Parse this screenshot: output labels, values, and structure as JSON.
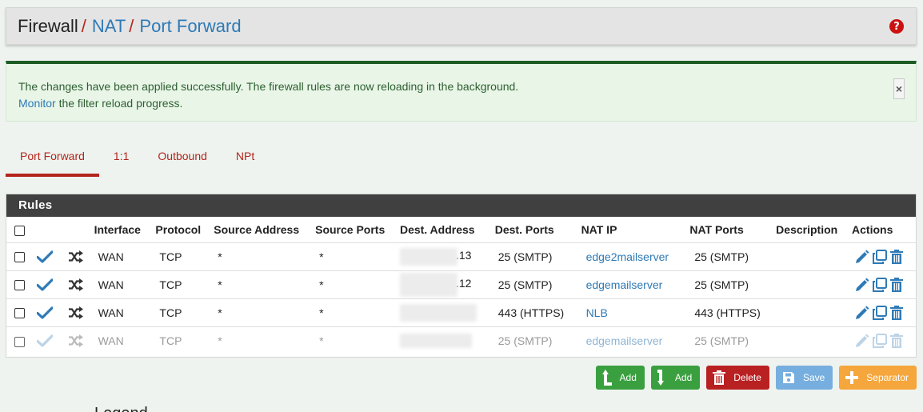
{
  "breadcrumb": {
    "items": [
      "Firewall",
      "NAT",
      "Port Forward"
    ],
    "separator": "/"
  },
  "alert": {
    "line1": "The changes have been applied successfully. The firewall rules are now reloading in the background.",
    "monitor_link": "Monitor",
    "line2_rest": " the filter reload progress.",
    "close_label": "×"
  },
  "help_icon": "?",
  "tabs": [
    {
      "label": "Port Forward",
      "active": true
    },
    {
      "label": "1:1",
      "active": false
    },
    {
      "label": "Outbound",
      "active": false
    },
    {
      "label": "NPt",
      "active": false
    }
  ],
  "panel": {
    "title": "Rules",
    "columns": [
      "Interface",
      "Protocol",
      "Source Address",
      "Source Ports",
      "Dest. Address",
      "Dest. Ports",
      "NAT IP",
      "NAT Ports",
      "Description",
      "Actions"
    ],
    "rows": [
      {
        "enabled": true,
        "interface": "WAN",
        "protocol": "TCP",
        "src_addr": "*",
        "src_ports": "*",
        "dest_suffix": ".13",
        "dest_ports": "25 (SMTP)",
        "nat_ip": "edge2mailserver",
        "nat_ports": "25 (SMTP)",
        "description": ""
      },
      {
        "enabled": true,
        "interface": "WAN",
        "protocol": "TCP",
        "src_addr": "*",
        "src_ports": "*",
        "dest_suffix": ".12",
        "dest_ports": "25 (SMTP)",
        "nat_ip": "edgemailserver",
        "nat_ports": "25 (SMTP)",
        "description": ""
      },
      {
        "enabled": true,
        "interface": "WAN",
        "protocol": "TCP",
        "src_addr": "*",
        "src_ports": "*",
        "dest_suffix": "",
        "dest_ports": "443 (HTTPS)",
        "nat_ip": "NLB",
        "nat_ports": "443 (HTTPS)",
        "description": ""
      },
      {
        "enabled": false,
        "interface": "WAN",
        "protocol": "TCP",
        "src_addr": "*",
        "src_ports": "*",
        "dest_suffix": "",
        "dest_ports": "25 (SMTP)",
        "nat_ip": "edgemailserver",
        "nat_ports": "25 (SMTP)",
        "description": ""
      }
    ]
  },
  "buttons": {
    "add_top": "Add",
    "add_bottom": "Add",
    "delete": "Delete",
    "save": "Save",
    "separator": "Separator"
  },
  "bottom_fragment": "Legend",
  "icons": {
    "enabled": "check-icon",
    "rule_type": "shuffle-icon",
    "edit": "pencil-icon",
    "copy": "copy-icon",
    "delete": "trash-icon"
  },
  "colors": {
    "link": "#2e7ab6",
    "accent_red": "#b3251b",
    "success_border": "#1d5c25",
    "panel_header": "#404040",
    "btn_green": "#3a9f3f",
    "btn_red": "#b92022",
    "btn_blue": "#76aedf",
    "btn_orange": "#f5a63c"
  }
}
